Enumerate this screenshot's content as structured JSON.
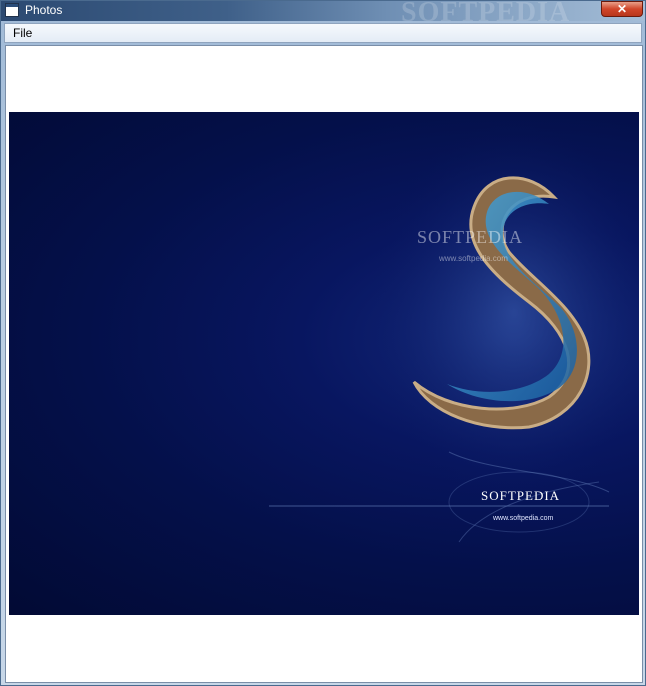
{
  "window": {
    "title": "Photos",
    "titlebar_watermark": "SOFTPEDIA",
    "close_glyph": "✕"
  },
  "menu": {
    "items": [
      {
        "label": "File"
      }
    ]
  },
  "photo": {
    "subject": "wallpaper-image",
    "logo_text": "SOFTPEDIA",
    "url_text": "www.softpedia.com",
    "watermark_text": "SOFTPEDIA",
    "watermark_url": "www.softpedia.com"
  },
  "colors": {
    "titlebar": "#2c4a72",
    "close_button": "#d0462a",
    "image_background": "#04104a"
  }
}
